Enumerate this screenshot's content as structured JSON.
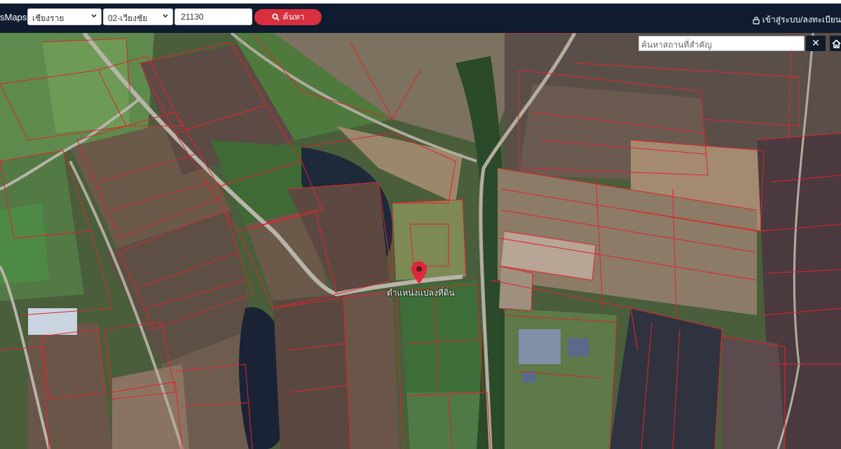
{
  "header": {
    "brand": "sMaps",
    "province": "เชียงราย",
    "district": "02-เวียงชัย",
    "postcode": "21130",
    "search_label": "ค้นหา",
    "login_label": "เข้าสู่ระบบ/ลงทะเบียน"
  },
  "map": {
    "place_search_placeholder": "ค้นหาสถานที่สำคัญ",
    "clear_label": "✕",
    "marker_label": "ตำแหน่งแปลงที่ดิน",
    "colors": {
      "parcel_border": "#e0242c",
      "navbar": "#0f1b2e",
      "search_button": "#d92f3f",
      "marker": "#e0263b"
    }
  }
}
